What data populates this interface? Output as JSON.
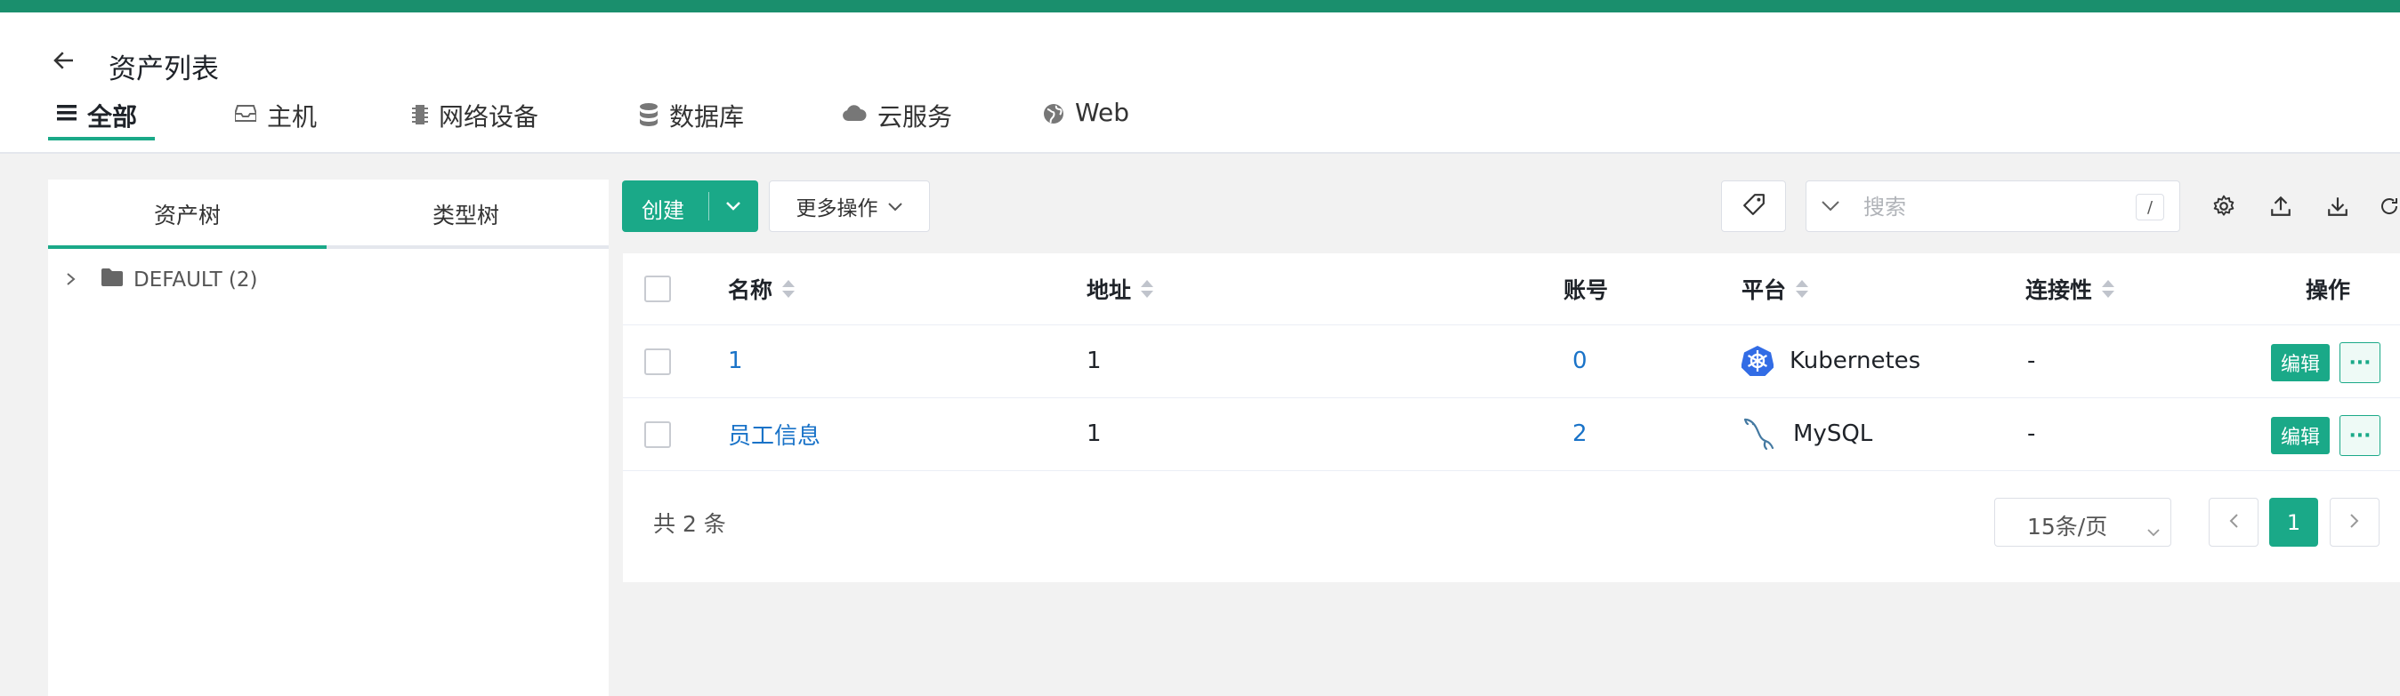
{
  "header": {
    "title": "资产列表",
    "tabs": [
      {
        "label": "全部",
        "icon": "list-icon",
        "active": true
      },
      {
        "label": "主机",
        "icon": "inbox-icon",
        "active": false
      },
      {
        "label": "网络设备",
        "icon": "chip-icon",
        "active": false
      },
      {
        "label": "数据库",
        "icon": "database-icon",
        "active": false
      },
      {
        "label": "云服务",
        "icon": "cloud-icon",
        "active": false
      },
      {
        "label": "Web",
        "icon": "globe-icon",
        "active": false
      }
    ]
  },
  "left_panel": {
    "tabs": [
      "资产树",
      "类型树"
    ],
    "tree": [
      {
        "label": "DEFAULT (2)",
        "icon": "folder-icon"
      }
    ]
  },
  "toolbar": {
    "create_label": "创建",
    "more_label": "更多操作",
    "search_placeholder": "搜索",
    "search_shortcut": "/"
  },
  "table": {
    "columns": [
      "名称",
      "地址",
      "账号",
      "平台",
      "连接性",
      "操作"
    ],
    "rows": [
      {
        "name": "1",
        "address": "1",
        "accounts": "0",
        "platform": "Kubernetes",
        "platform_icon": "kubernetes-icon",
        "connectivity": "-",
        "edit_label": "编辑",
        "more_label": "···"
      },
      {
        "name": "员工信息",
        "address": "1",
        "accounts": "2",
        "platform": "MySQL",
        "platform_icon": "mysql-icon",
        "connectivity": "-",
        "edit_label": "编辑",
        "more_label": "···"
      }
    ]
  },
  "pagination": {
    "total_text": "共 2 条",
    "page_size": "15条/页",
    "current_page": "1"
  },
  "colors": {
    "accent": "#1aa988",
    "top_bar": "#1a8f6d",
    "link": "#1a73c8"
  }
}
